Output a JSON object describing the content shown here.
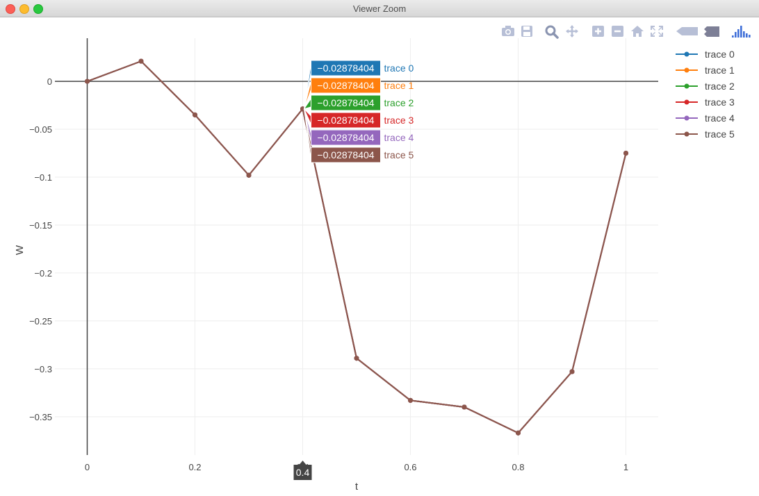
{
  "window": {
    "title": "Viewer Zoom"
  },
  "modebar": {
    "buttons": [
      {
        "name": "camera-icon",
        "label": "Download plot as a png"
      },
      {
        "name": "save-icon",
        "label": "Save"
      },
      {
        "name": "zoom-icon",
        "label": "Zoom"
      },
      {
        "name": "pan-icon",
        "label": "Pan"
      },
      {
        "name": "zoom-in-icon",
        "label": "Zoom in"
      },
      {
        "name": "zoom-out-icon",
        "label": "Zoom out"
      },
      {
        "name": "home-icon",
        "label": "Reset axes"
      },
      {
        "name": "autoscale-icon",
        "label": "Autoscale"
      },
      {
        "name": "spike-closest-icon",
        "label": "Show closest data on hover"
      },
      {
        "name": "spike-compare-icon",
        "label": "Compare data on hover"
      },
      {
        "name": "plotly-logo-icon",
        "label": "Produced with Plotly"
      }
    ],
    "icon_color": "#b7bfd6",
    "active_color": "#8a94b0",
    "logo_color": "#3f6fd8"
  },
  "chart_data": {
    "type": "line",
    "xlabel": "t",
    "ylabel": "W",
    "xlim": [
      -0.06,
      1.06
    ],
    "ylim": [
      -0.39,
      0.045
    ],
    "x_ticks": [
      0,
      0.2,
      0.4,
      0.6,
      0.8,
      1
    ],
    "x_tick_labels": [
      "0",
      "0.2",
      "0.4",
      "0.6",
      "0.8",
      "1"
    ],
    "y_ticks": [
      0,
      -0.05,
      -0.1,
      -0.15,
      -0.2,
      -0.25,
      -0.3,
      -0.35
    ],
    "y_tick_labels": [
      "0",
      "−0.05",
      "−0.1",
      "−0.15",
      "−0.2",
      "−0.25",
      "−0.3",
      "−0.35"
    ],
    "grid": true,
    "zero_lines": true,
    "legend_position": "top-right",
    "x": [
      0,
      0.1,
      0.2,
      0.3,
      0.4,
      0.5,
      0.6,
      0.7,
      0.8,
      0.9,
      1.0
    ],
    "series": [
      {
        "name": "trace 0",
        "color": "#1f77b4",
        "values": [
          0,
          0.021,
          -0.035,
          -0.098,
          -0.02878404,
          -0.289,
          -0.333,
          -0.34,
          -0.367,
          -0.303,
          -0.075
        ]
      },
      {
        "name": "trace 1",
        "color": "#ff7f0e",
        "values": [
          0,
          0.021,
          -0.035,
          -0.098,
          -0.02878404,
          -0.289,
          -0.333,
          -0.34,
          -0.367,
          -0.303,
          -0.075
        ]
      },
      {
        "name": "trace 2",
        "color": "#2ca02c",
        "values": [
          0,
          0.021,
          -0.035,
          -0.098,
          -0.02878404,
          -0.289,
          -0.333,
          -0.34,
          -0.367,
          -0.303,
          -0.075
        ]
      },
      {
        "name": "trace 3",
        "color": "#d62728",
        "values": [
          0,
          0.021,
          -0.035,
          -0.098,
          -0.02878404,
          -0.289,
          -0.333,
          -0.34,
          -0.367,
          -0.303,
          -0.075
        ]
      },
      {
        "name": "trace 4",
        "color": "#9467bd",
        "values": [
          0,
          0.021,
          -0.035,
          -0.098,
          -0.02878404,
          -0.289,
          -0.333,
          -0.34,
          -0.367,
          -0.303,
          -0.075
        ]
      },
      {
        "name": "trace 5",
        "color": "#8c564b",
        "values": [
          0,
          0.021,
          -0.035,
          -0.098,
          -0.02878404,
          -0.289,
          -0.333,
          -0.34,
          -0.367,
          -0.303,
          -0.075
        ]
      }
    ],
    "hover": {
      "x_label": "0.4",
      "x": 0.4,
      "y": -0.02878404,
      "labels": [
        {
          "value": "−0.02878404",
          "name": "trace 0",
          "color": "#1f77b4"
        },
        {
          "value": "−0.02878404",
          "name": "trace 1",
          "color": "#ff7f0e"
        },
        {
          "value": "−0.02878404",
          "name": "trace 2",
          "color": "#2ca02c"
        },
        {
          "value": "−0.02878404",
          "name": "trace 3",
          "color": "#d62728"
        },
        {
          "value": "−0.02878404",
          "name": "trace 4",
          "color": "#9467bd"
        },
        {
          "value": "−0.02878404",
          "name": "trace 5",
          "color": "#8c564b"
        }
      ]
    }
  }
}
